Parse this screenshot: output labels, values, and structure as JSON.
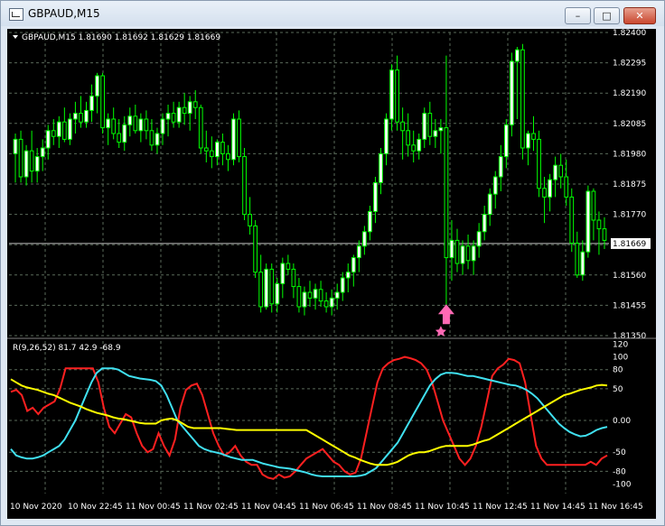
{
  "window": {
    "title": "GBPAUD,M15",
    "min_label": "–",
    "max_label": "□",
    "close_label": "✕"
  },
  "colors": {
    "background": "#000000",
    "grid": "#5a6a5a",
    "bull_candle": "#ffffff",
    "bear_candle": "#000000",
    "wick": "#00ff00",
    "price_line": "#c0c0c0",
    "arrow": "#ff69b4",
    "red_line": "#ff2020",
    "cyan_line": "#40e0f0",
    "yellow_line": "#ffff00",
    "text": "#ffffff"
  },
  "chart_data": [
    {
      "type": "candlestick",
      "title": "GBPAUD,M15  1.81690 1.81692 1.81629 1.81669",
      "ylim": [
        1.8135,
        1.824
      ],
      "y_ticks": [
        "1.82400",
        "1.82295",
        "1.82190",
        "1.82085",
        "1.81980",
        "1.81875",
        "1.81770",
        "1.81669",
        "1.81560",
        "1.81455",
        "1.81350"
      ],
      "current_price": "1.81669",
      "grid": true,
      "signal_marker": {
        "kind": "arrow-up",
        "x_index": 79,
        "price": 1.8139
      },
      "candles": [
        [
          1.8198,
          1.8205,
          1.8188,
          1.8203
        ],
        [
          1.8203,
          1.8206,
          1.8188,
          1.819
        ],
        [
          1.819,
          1.8201,
          1.8187,
          1.8199
        ],
        [
          1.8199,
          1.8206,
          1.8188,
          1.8192
        ],
        [
          1.8192,
          1.82,
          1.8188,
          1.8197
        ],
        [
          1.8197,
          1.8203,
          1.8192,
          1.82
        ],
        [
          1.82,
          1.8208,
          1.8196,
          1.8206
        ],
        [
          1.8206,
          1.821,
          1.8201,
          1.8204
        ],
        [
          1.8204,
          1.8211,
          1.82,
          1.8209
        ],
        [
          1.8209,
          1.8214,
          1.8202,
          1.8203
        ],
        [
          1.8203,
          1.8212,
          1.8201,
          1.821
        ],
        [
          1.821,
          1.8216,
          1.8205,
          1.8212
        ],
        [
          1.8212,
          1.8218,
          1.8207,
          1.8209
        ],
        [
          1.8209,
          1.8216,
          1.8207,
          1.8213
        ],
        [
          1.8213,
          1.8222,
          1.8209,
          1.8218
        ],
        [
          1.8218,
          1.8226,
          1.8212,
          1.8225
        ],
        [
          1.8225,
          1.8226,
          1.8205,
          1.8207
        ],
        [
          1.8207,
          1.8212,
          1.8201,
          1.821
        ],
        [
          1.821,
          1.8214,
          1.8203,
          1.8205
        ],
        [
          1.8205,
          1.821,
          1.82,
          1.8202
        ],
        [
          1.8202,
          1.8211,
          1.8199,
          1.8208
        ],
        [
          1.8208,
          1.8214,
          1.8204,
          1.8211
        ],
        [
          1.8211,
          1.8215,
          1.8205,
          1.8206
        ],
        [
          1.8206,
          1.8212,
          1.8202,
          1.821
        ],
        [
          1.821,
          1.8213,
          1.8203,
          1.8206
        ],
        [
          1.8206,
          1.821,
          1.8199,
          1.8201
        ],
        [
          1.8201,
          1.8207,
          1.8198,
          1.8205
        ],
        [
          1.8205,
          1.8212,
          1.8201,
          1.821
        ],
        [
          1.821,
          1.8215,
          1.8204,
          1.8212
        ],
        [
          1.8212,
          1.8216,
          1.8207,
          1.8209
        ],
        [
          1.8209,
          1.8216,
          1.8207,
          1.8214
        ],
        [
          1.8214,
          1.8219,
          1.8208,
          1.8212
        ],
        [
          1.8212,
          1.8218,
          1.8206,
          1.8216
        ],
        [
          1.8216,
          1.822,
          1.821,
          1.8214
        ],
        [
          1.8214,
          1.8215,
          1.8198,
          1.82
        ],
        [
          1.82,
          1.8206,
          1.8195,
          1.8199
        ],
        [
          1.8199,
          1.8204,
          1.8193,
          1.8197
        ],
        [
          1.8197,
          1.8203,
          1.8194,
          1.8202
        ],
        [
          1.8202,
          1.8205,
          1.8194,
          1.8198
        ],
        [
          1.8198,
          1.8201,
          1.8192,
          1.8196
        ],
        [
          1.8196,
          1.8212,
          1.8194,
          1.821
        ],
        [
          1.821,
          1.8213,
          1.8195,
          1.8197
        ],
        [
          1.8197,
          1.82,
          1.8175,
          1.8177
        ],
        [
          1.8177,
          1.8183,
          1.817,
          1.8173
        ],
        [
          1.8173,
          1.8175,
          1.8155,
          1.8157
        ],
        [
          1.8157,
          1.8163,
          1.8143,
          1.8145
        ],
        [
          1.8145,
          1.816,
          1.8144,
          1.8158
        ],
        [
          1.8158,
          1.816,
          1.8143,
          1.8146
        ],
        [
          1.8146,
          1.8155,
          1.8143,
          1.8153
        ],
        [
          1.8153,
          1.8162,
          1.8148,
          1.816
        ],
        [
          1.816,
          1.8163,
          1.8156,
          1.8158
        ],
        [
          1.8158,
          1.816,
          1.8148,
          1.8152
        ],
        [
          1.8152,
          1.8155,
          1.8143,
          1.8145
        ],
        [
          1.8145,
          1.8152,
          1.8142,
          1.815
        ],
        [
          1.815,
          1.8154,
          1.8145,
          1.8148
        ],
        [
          1.8148,
          1.8153,
          1.8144,
          1.8151
        ],
        [
          1.8151,
          1.8154,
          1.8145,
          1.8147
        ],
        [
          1.8147,
          1.815,
          1.8143,
          1.8145
        ],
        [
          1.8145,
          1.8151,
          1.8142,
          1.8148
        ],
        [
          1.8148,
          1.8153,
          1.8144,
          1.815
        ],
        [
          1.815,
          1.8157,
          1.8147,
          1.8155
        ],
        [
          1.8155,
          1.816,
          1.815,
          1.8157
        ],
        [
          1.8157,
          1.8163,
          1.8152,
          1.8162
        ],
        [
          1.8162,
          1.8168,
          1.8157,
          1.8166
        ],
        [
          1.8166,
          1.8173,
          1.8163,
          1.8171
        ],
        [
          1.8171,
          1.818,
          1.8168,
          1.8178
        ],
        [
          1.8178,
          1.819,
          1.8174,
          1.8188
        ],
        [
          1.8188,
          1.82,
          1.8184,
          1.8198
        ],
        [
          1.8198,
          1.8212,
          1.8194,
          1.821
        ],
        [
          1.821,
          1.8229,
          1.8206,
          1.8227
        ],
        [
          1.8227,
          1.8232,
          1.8206,
          1.8209
        ],
        [
          1.8209,
          1.8214,
          1.8196,
          1.8206
        ],
        [
          1.8206,
          1.8212,
          1.8197,
          1.8201
        ],
        [
          1.8201,
          1.8206,
          1.8195,
          1.8199
        ],
        [
          1.8199,
          1.8205,
          1.8196,
          1.8203
        ],
        [
          1.8203,
          1.8214,
          1.82,
          1.8212
        ],
        [
          1.8212,
          1.8216,
          1.8201,
          1.8204
        ],
        [
          1.8204,
          1.821,
          1.82,
          1.8206
        ],
        [
          1.8206,
          1.821,
          1.8198,
          1.8207
        ],
        [
          1.8207,
          1.8232,
          1.814,
          1.8162
        ],
        [
          1.8162,
          1.8175,
          1.8154,
          1.8168
        ],
        [
          1.8168,
          1.8172,
          1.8157,
          1.816
        ],
        [
          1.816,
          1.8168,
          1.8156,
          1.8166
        ],
        [
          1.8166,
          1.817,
          1.8158,
          1.8161
        ],
        [
          1.8161,
          1.8168,
          1.8156,
          1.8166
        ],
        [
          1.8166,
          1.8174,
          1.8162,
          1.8171
        ],
        [
          1.8171,
          1.818,
          1.8168,
          1.8177
        ],
        [
          1.8177,
          1.8186,
          1.8173,
          1.8184
        ],
        [
          1.8184,
          1.8192,
          1.8179,
          1.819
        ],
        [
          1.819,
          1.8201,
          1.8185,
          1.8197
        ],
        [
          1.8197,
          1.821,
          1.8193,
          1.8208
        ],
        [
          1.8208,
          1.8233,
          1.8204,
          1.823
        ],
        [
          1.823,
          1.8235,
          1.821,
          1.8234
        ],
        [
          1.8234,
          1.8236,
          1.8196,
          1.82
        ],
        [
          1.82,
          1.8206,
          1.8194,
          1.8205
        ],
        [
          1.8205,
          1.8211,
          1.8199,
          1.8203
        ],
        [
          1.8203,
          1.8206,
          1.8183,
          1.8186
        ],
        [
          1.8186,
          1.819,
          1.8174,
          1.8183
        ],
        [
          1.8183,
          1.8191,
          1.8178,
          1.8189
        ],
        [
          1.8189,
          1.8197,
          1.8183,
          1.8194
        ],
        [
          1.8194,
          1.8198,
          1.8186,
          1.819
        ],
        [
          1.819,
          1.8196,
          1.818,
          1.8183
        ],
        [
          1.8183,
          1.8186,
          1.8164,
          1.8167
        ],
        [
          1.8167,
          1.8171,
          1.8155,
          1.8156
        ],
        [
          1.8156,
          1.8168,
          1.8154,
          1.8164
        ],
        [
          1.8164,
          1.8187,
          1.8162,
          1.8185
        ],
        [
          1.8185,
          1.8186,
          1.8168,
          1.8175
        ],
        [
          1.8175,
          1.8178,
          1.8163,
          1.8172
        ],
        [
          1.8172,
          1.8176,
          1.8165,
          1.8168
        ]
      ]
    },
    {
      "type": "line",
      "title": "R(9,26,52) 81.7 42.9 -68.9",
      "ylim": [
        -115,
        125
      ],
      "y_ticks": [
        "120",
        "100",
        "80",
        "50",
        "0.00",
        "-50",
        "-80",
        "-100"
      ],
      "x_tick_labels": [
        "10 Nov 2020",
        "10 Nov 22:45",
        "11 Nov 00:45",
        "11 Nov 02:45",
        "11 Nov 04:45",
        "11 Nov 06:45",
        "11 Nov 08:45",
        "11 Nov 10:45",
        "11 Nov 12:45",
        "11 Nov 14:45",
        "11 Nov 16:45"
      ],
      "series": [
        {
          "color": "#ff2020",
          "values": [
            45,
            48,
            40,
            15,
            20,
            10,
            20,
            25,
            30,
            50,
            82,
            82,
            82,
            82,
            82,
            82,
            60,
            20,
            -10,
            -20,
            -5,
            10,
            5,
            -20,
            -40,
            -50,
            -45,
            -20,
            -40,
            -55,
            -30,
            20,
            48,
            55,
            58,
            40,
            10,
            -20,
            -40,
            -55,
            -50,
            -40,
            -55,
            -65,
            -70,
            -70,
            -85,
            -90,
            -92,
            -85,
            -90,
            -88,
            -80,
            -70,
            -60,
            -55,
            -50,
            -45,
            -55,
            -65,
            -70,
            -80,
            -85,
            -82,
            -60,
            -20,
            20,
            60,
            82,
            90,
            95,
            97,
            100,
            98,
            95,
            90,
            80,
            60,
            30,
            0,
            -20,
            -40,
            -60,
            -70,
            -60,
            -40,
            -10,
            30,
            70,
            82,
            88,
            97,
            95,
            90,
            60,
            10,
            -40,
            -60,
            -70,
            -70,
            -70,
            -70,
            -70,
            -70,
            -70,
            -70,
            -65,
            -70,
            -60,
            -55
          ]
        },
        {
          "color": "#40e0f0",
          "values": [
            -45,
            -55,
            -58,
            -60,
            -60,
            -58,
            -55,
            -50,
            -45,
            -40,
            -30,
            -15,
            0,
            20,
            40,
            60,
            75,
            82,
            82,
            82,
            80,
            75,
            70,
            68,
            66,
            65,
            64,
            62,
            55,
            40,
            20,
            0,
            -10,
            -20,
            -30,
            -40,
            -45,
            -48,
            -50,
            -52,
            -55,
            -58,
            -60,
            -62,
            -62,
            -62,
            -65,
            -68,
            -70,
            -72,
            -74,
            -75,
            -76,
            -78,
            -80,
            -82,
            -85,
            -87,
            -88,
            -88,
            -88,
            -88,
            -88,
            -88,
            -88,
            -87,
            -85,
            -80,
            -75,
            -65,
            -55,
            -45,
            -35,
            -20,
            -5,
            10,
            25,
            40,
            55,
            65,
            72,
            75,
            75,
            74,
            72,
            70,
            70,
            68,
            66,
            64,
            62,
            60,
            58,
            56,
            55,
            52,
            48,
            42,
            35,
            25,
            15,
            5,
            -5,
            -12,
            -18,
            -22,
            -25,
            -24,
            -20,
            -15,
            -12,
            -10
          ]
        },
        {
          "color": "#ffff00",
          "values": [
            65,
            60,
            55,
            52,
            50,
            48,
            45,
            42,
            40,
            36,
            32,
            28,
            25,
            22,
            18,
            15,
            12,
            10,
            8,
            5,
            3,
            2,
            0,
            -2,
            -4,
            -5,
            -5,
            -5,
            0,
            2,
            3,
            0,
            -5,
            -10,
            -12,
            -12,
            -12,
            -12,
            -12,
            -12,
            -13,
            -14,
            -15,
            -15,
            -15,
            -15,
            -15,
            -15,
            -15,
            -15,
            -15,
            -15,
            -15,
            -15,
            -15,
            -15,
            -20,
            -25,
            -30,
            -35,
            -40,
            -45,
            -50,
            -55,
            -58,
            -62,
            -65,
            -68,
            -70,
            -70,
            -70,
            -68,
            -65,
            -60,
            -55,
            -52,
            -50,
            -50,
            -48,
            -45,
            -42,
            -40,
            -40,
            -40,
            -40,
            -40,
            -38,
            -35,
            -32,
            -30,
            -25,
            -20,
            -15,
            -10,
            -5,
            0,
            5,
            10,
            15,
            20,
            25,
            30,
            35,
            40,
            42,
            45,
            48,
            50,
            52,
            55,
            56,
            55
          ]
        }
      ]
    }
  ]
}
